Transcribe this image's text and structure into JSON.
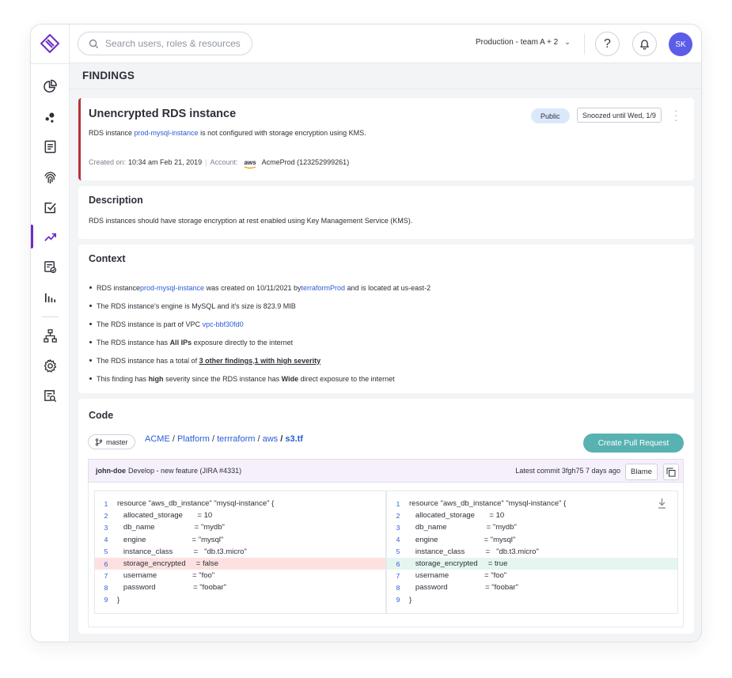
{
  "search": {
    "placeholder": "Search users, roles & resources"
  },
  "topbar": {
    "environment": "Production - team A + 2",
    "help_glyph": "?",
    "avatar_initials": "SK"
  },
  "page": {
    "title": "FINDINGS"
  },
  "finding": {
    "title": "Unencrypted RDS instance",
    "badge_public": "Public",
    "snooze": "Snoozed until Wed, 1/9",
    "desc_prefix": "RDS instance ",
    "desc_link": "prod-mysql-instance",
    "desc_suffix": " is not configured with storage encryption using KMS.",
    "created_label": "Created on:",
    "created_value": "10:34 am Feb 21, 2019",
    "account_label": "Account:",
    "account_logo": "aws",
    "account_value": "AcmeProd (123252999261)"
  },
  "description": {
    "heading": "Description",
    "text": "RDS instances should have storage encryption at rest enabled using Key Management Service (KMS)."
  },
  "context": {
    "heading": "Context",
    "i1_a": "RDS instance ",
    "i1_link1": "prod-mysql-instance",
    "i1_b": " was created on 10/11/2021 by ",
    "i1_link2": "terraformProd",
    "i1_c": " and is located at us-east-2",
    "i2": "The RDS instance's engine is MySQL and it's size is 823.9 MIB",
    "i3_a": "The RDS instance is part of VPC ",
    "i3_link": "vpc-bbf30fd0",
    "i4_a": "The RDS instance has ",
    "i4_bold": "All IPs",
    "i4_b": " exposure directly to the internet",
    "i5_a": "The RDS instance has a total of ",
    "i5_u1": "3 other findings",
    "i5_comma": ", ",
    "i5_u2": "1 with high severity",
    "i6_a": "This finding has ",
    "i6_bold1": "high",
    "i6_b": " severity since the RDS instance has ",
    "i6_bold2": "Wide",
    "i6_c": " direct exposure to the internet"
  },
  "code": {
    "heading": "Code",
    "branch": "master",
    "breadcrumb": [
      "ACME",
      "Platform",
      "terrraform",
      "aws",
      "s3.tf"
    ],
    "breadcrumb_sep": "/",
    "create_pr": "Create Pull Request",
    "commit_author": "john-doe",
    "commit_message": "Develop - new feature (JIRA #4331)",
    "latest_commit": "Latest commit 3fgh75 7 days ago",
    "blame": "Blame",
    "left_lines": [
      {
        "n": "1",
        "code": "resource \"aws_db_instance\" \"mysql-instance\" {"
      },
      {
        "n": "2",
        "code": "   allocated_storage       = 10"
      },
      {
        "n": "3",
        "code": "   db_name                   = \"mydb\""
      },
      {
        "n": "4",
        "code": "   engine                      = \"mysql\""
      },
      {
        "n": "5",
        "code": "   instance_class          =   \"db.t3.micro\""
      },
      {
        "n": "6",
        "code": "   storage_encrypted     = false"
      },
      {
        "n": "7",
        "code": "   username                 = \"foo\""
      },
      {
        "n": "8",
        "code": "   password                  = \"foobar\""
      },
      {
        "n": "9",
        "code": "}"
      }
    ],
    "right_lines": [
      {
        "n": "1",
        "code": "resource \"aws_db_instance\" \"mysql-instance\" {"
      },
      {
        "n": "2",
        "code": "   allocated_storage       = 10"
      },
      {
        "n": "3",
        "code": "   db_name                   = \"mydb\""
      },
      {
        "n": "4",
        "code": "   engine                      = \"mysql\""
      },
      {
        "n": "5",
        "code": "   instance_class          =   \"db.t3.micro\""
      },
      {
        "n": "6",
        "code": "   storage_encrypted     = true"
      },
      {
        "n": "7",
        "code": "   username                 = \"foo\""
      },
      {
        "n": "8",
        "code": "   password                  = \"foobar\""
      },
      {
        "n": "9",
        "code": "}"
      }
    ]
  },
  "colors": {
    "accent_purple": "#6d2cc6",
    "severity_red": "#b8313a",
    "link_blue": "#2a5bd7",
    "pr_teal": "#58b2b1",
    "avatar": "#5b5ce8"
  },
  "icons": [
    "logo-icon",
    "pie-chart-icon",
    "dots-icon",
    "document-icon",
    "fingerprint-icon",
    "checkbox-icon",
    "trend-icon",
    "report-icon",
    "bar-chart-icon",
    "hierarchy-icon",
    "gear-icon",
    "search-doc-icon",
    "search-icon",
    "help-icon",
    "bell-icon",
    "branch-icon",
    "copy-icon",
    "download-icon"
  ]
}
